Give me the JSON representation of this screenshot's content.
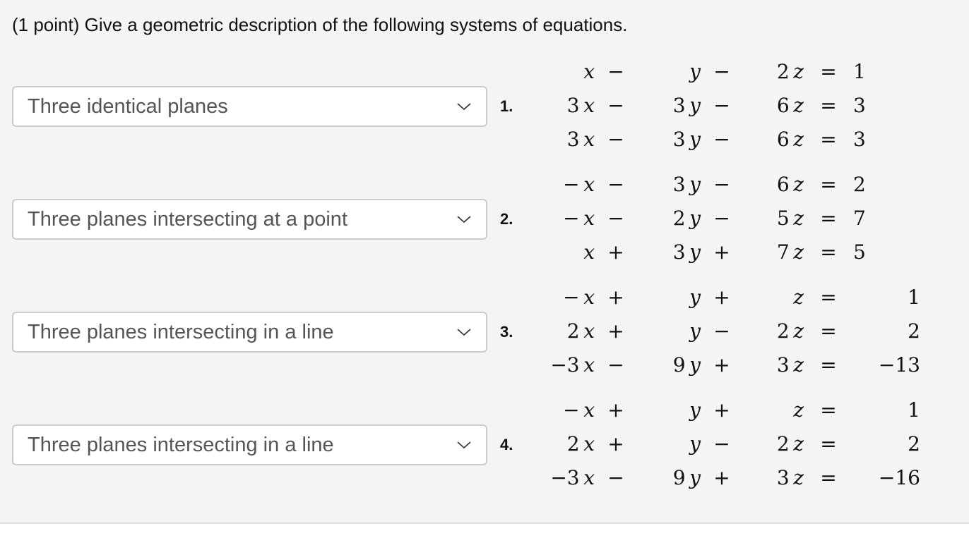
{
  "question": "(1 point) Give a geometric description of the following systems of equations.",
  "systems": [
    {
      "number": "1.",
      "answer": "Three identical planes",
      "rows": [
        {
          "x": "",
          "xv": "x",
          "op1": "−",
          "y": "",
          "yv": "y",
          "op2": "−",
          "z": "2",
          "zv": "z",
          "eq": "=",
          "rhs": "1"
        },
        {
          "x": "3",
          "xv": "x",
          "op1": "−",
          "y": "3",
          "yv": "y",
          "op2": "−",
          "z": "6",
          "zv": "z",
          "eq": "=",
          "rhs": "3"
        },
        {
          "x": "3",
          "xv": "x",
          "op1": "−",
          "y": "3",
          "yv": "y",
          "op2": "−",
          "z": "6",
          "zv": "z",
          "eq": "=",
          "rhs": "3"
        }
      ]
    },
    {
      "number": "2.",
      "answer": "Three planes intersecting at a point",
      "rows": [
        {
          "x": "−",
          "xv": "x",
          "op1": "−",
          "y": "3",
          "yv": "y",
          "op2": "−",
          "z": "6",
          "zv": "z",
          "eq": "=",
          "rhs": "2"
        },
        {
          "x": "−",
          "xv": "x",
          "op1": "−",
          "y": "2",
          "yv": "y",
          "op2": "−",
          "z": "5",
          "zv": "z",
          "eq": "=",
          "rhs": "7"
        },
        {
          "x": "",
          "xv": "x",
          "op1": "+",
          "y": "3",
          "yv": "y",
          "op2": "+",
          "z": "7",
          "zv": "z",
          "eq": "=",
          "rhs": "5"
        }
      ]
    },
    {
      "number": "3.",
      "answer": "Three planes intersecting in a line",
      "rows": [
        {
          "x": "−",
          "xv": "x",
          "op1": "+",
          "y": "",
          "yv": "y",
          "op2": "+",
          "z": "",
          "zv": "z",
          "eq": "=",
          "rhs": "1"
        },
        {
          "x": "2",
          "xv": "x",
          "op1": "+",
          "y": "",
          "yv": "y",
          "op2": "−",
          "z": "2",
          "zv": "z",
          "eq": "=",
          "rhs": "2"
        },
        {
          "x": "−3",
          "xv": "x",
          "op1": "−",
          "y": "9",
          "yv": "y",
          "op2": "+",
          "z": "3",
          "zv": "z",
          "eq": "=",
          "rhs": "−13"
        }
      ]
    },
    {
      "number": "4.",
      "answer": "Three planes intersecting in a line",
      "rows": [
        {
          "x": "−",
          "xv": "x",
          "op1": "+",
          "y": "",
          "yv": "y",
          "op2": "+",
          "z": "",
          "zv": "z",
          "eq": "=",
          "rhs": "1"
        },
        {
          "x": "2",
          "xv": "x",
          "op1": "+",
          "y": "",
          "yv": "y",
          "op2": "−",
          "z": "2",
          "zv": "z",
          "eq": "=",
          "rhs": "2"
        },
        {
          "x": "−3",
          "xv": "x",
          "op1": "−",
          "y": "9",
          "yv": "y",
          "op2": "+",
          "z": "3",
          "zv": "z",
          "eq": "=",
          "rhs": "−16"
        }
      ]
    }
  ]
}
